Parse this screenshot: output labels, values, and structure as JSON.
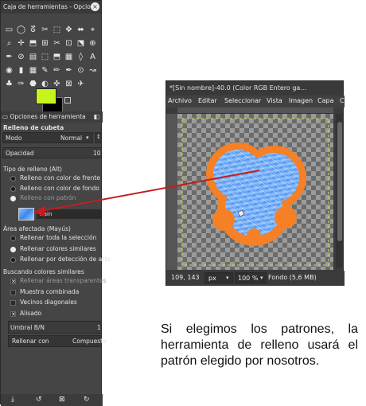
{
  "toolbox": {
    "title": "Caja de herramientas - Opcio...",
    "close_glyph": "×",
    "tools": [
      "▭",
      "◯",
      "ᘔ",
      "✂",
      "⬚",
      "✥",
      "⬌",
      "⌖",
      "⌕",
      "✛",
      "⬒",
      "⊞",
      "✂",
      "⊡",
      "⬔",
      "⊕",
      "✒",
      "⊘",
      "▤",
      "⬚",
      "⬒",
      "▦",
      "◊",
      "A",
      "◉",
      "▮",
      "▦",
      "✎",
      "✏",
      "✒",
      "⊙",
      "↝",
      "♣",
      "✑",
      "⬣",
      "◐",
      "✜",
      "⊠",
      "✈",
      ""
    ],
    "colors": {
      "foreground": "#c6f41c",
      "background": "#000000"
    },
    "options_tab": "Opciones de herramienta",
    "tab_menu_glyph": "◧",
    "tool_name": "Relleno de cubeta",
    "mode_label": "Modo",
    "mode_value": "Normal",
    "opacity_label": "Opacidad",
    "opacity_value": "10",
    "fill_type_label": "Tipo de relleno  (Alt)",
    "fill_options": [
      "Relleno con color de frente",
      "Relleno con color de fondo",
      "Relleno con patrón"
    ],
    "fill_selected": 2,
    "pattern_name": "Rain",
    "affected_label": "Área afectada  (Mayús)",
    "affected_options": [
      "Rellenar toda la selección",
      "Rellenar colores similares",
      "Rellenar por detección de arte"
    ],
    "affected_selected": 1,
    "similar_label": "Buscando colores similares",
    "similar_checks": [
      {
        "label": "Rellenar áreas transparentes",
        "checked": true,
        "dim": true
      },
      {
        "label": "Muestra combinada",
        "checked": false,
        "dim": false
      },
      {
        "label": "Vecinos diagonales",
        "checked": false,
        "dim": false
      },
      {
        "label": "Alisado",
        "checked": true,
        "dim": false
      }
    ],
    "threshold_label": "Umbral B/N",
    "threshold_value": "1",
    "fill_with_label": "Rellenar con",
    "fill_with_value": "Compuesto",
    "bottom_icons": [
      "⤓",
      "↺",
      "⊠",
      "↻"
    ]
  },
  "image_window": {
    "title": "*[Sin nombre]-40.0 (Color RGB Entero ga...",
    "menu": [
      "Archivo",
      "Editar",
      "Seleccionar",
      "Vista",
      "Imagen",
      "Capa",
      "C"
    ],
    "coords": "109, 143",
    "unit": "px",
    "zoom": "100 %",
    "status": "Fondo (5,6 MB)",
    "colors": {
      "ring": "#f58025",
      "fill": "#6ea8ec"
    }
  },
  "caption": "Si elegimos los patrones, la herramienta de relleno usará el patrón elegido por nosotros.",
  "arrow_color": "#c41e1e"
}
